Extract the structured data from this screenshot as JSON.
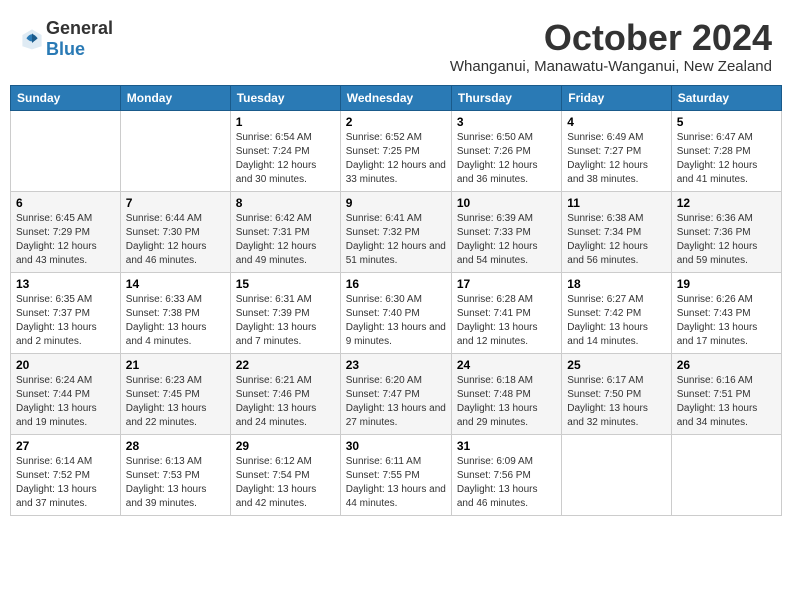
{
  "header": {
    "logo_general": "General",
    "logo_blue": "Blue",
    "month": "October 2024",
    "location": "Whanganui, Manawatu-Wanganui, New Zealand"
  },
  "weekdays": [
    "Sunday",
    "Monday",
    "Tuesday",
    "Wednesday",
    "Thursday",
    "Friday",
    "Saturday"
  ],
  "weeks": [
    [
      {
        "day": "",
        "info": ""
      },
      {
        "day": "",
        "info": ""
      },
      {
        "day": "1",
        "info": "Sunrise: 6:54 AM\nSunset: 7:24 PM\nDaylight: 12 hours and 30 minutes."
      },
      {
        "day": "2",
        "info": "Sunrise: 6:52 AM\nSunset: 7:25 PM\nDaylight: 12 hours and 33 minutes."
      },
      {
        "day": "3",
        "info": "Sunrise: 6:50 AM\nSunset: 7:26 PM\nDaylight: 12 hours and 36 minutes."
      },
      {
        "day": "4",
        "info": "Sunrise: 6:49 AM\nSunset: 7:27 PM\nDaylight: 12 hours and 38 minutes."
      },
      {
        "day": "5",
        "info": "Sunrise: 6:47 AM\nSunset: 7:28 PM\nDaylight: 12 hours and 41 minutes."
      }
    ],
    [
      {
        "day": "6",
        "info": "Sunrise: 6:45 AM\nSunset: 7:29 PM\nDaylight: 12 hours and 43 minutes."
      },
      {
        "day": "7",
        "info": "Sunrise: 6:44 AM\nSunset: 7:30 PM\nDaylight: 12 hours and 46 minutes."
      },
      {
        "day": "8",
        "info": "Sunrise: 6:42 AM\nSunset: 7:31 PM\nDaylight: 12 hours and 49 minutes."
      },
      {
        "day": "9",
        "info": "Sunrise: 6:41 AM\nSunset: 7:32 PM\nDaylight: 12 hours and 51 minutes."
      },
      {
        "day": "10",
        "info": "Sunrise: 6:39 AM\nSunset: 7:33 PM\nDaylight: 12 hours and 54 minutes."
      },
      {
        "day": "11",
        "info": "Sunrise: 6:38 AM\nSunset: 7:34 PM\nDaylight: 12 hours and 56 minutes."
      },
      {
        "day": "12",
        "info": "Sunrise: 6:36 AM\nSunset: 7:36 PM\nDaylight: 12 hours and 59 minutes."
      }
    ],
    [
      {
        "day": "13",
        "info": "Sunrise: 6:35 AM\nSunset: 7:37 PM\nDaylight: 13 hours and 2 minutes."
      },
      {
        "day": "14",
        "info": "Sunrise: 6:33 AM\nSunset: 7:38 PM\nDaylight: 13 hours and 4 minutes."
      },
      {
        "day": "15",
        "info": "Sunrise: 6:31 AM\nSunset: 7:39 PM\nDaylight: 13 hours and 7 minutes."
      },
      {
        "day": "16",
        "info": "Sunrise: 6:30 AM\nSunset: 7:40 PM\nDaylight: 13 hours and 9 minutes."
      },
      {
        "day": "17",
        "info": "Sunrise: 6:28 AM\nSunset: 7:41 PM\nDaylight: 13 hours and 12 minutes."
      },
      {
        "day": "18",
        "info": "Sunrise: 6:27 AM\nSunset: 7:42 PM\nDaylight: 13 hours and 14 minutes."
      },
      {
        "day": "19",
        "info": "Sunrise: 6:26 AM\nSunset: 7:43 PM\nDaylight: 13 hours and 17 minutes."
      }
    ],
    [
      {
        "day": "20",
        "info": "Sunrise: 6:24 AM\nSunset: 7:44 PM\nDaylight: 13 hours and 19 minutes."
      },
      {
        "day": "21",
        "info": "Sunrise: 6:23 AM\nSunset: 7:45 PM\nDaylight: 13 hours and 22 minutes."
      },
      {
        "day": "22",
        "info": "Sunrise: 6:21 AM\nSunset: 7:46 PM\nDaylight: 13 hours and 24 minutes."
      },
      {
        "day": "23",
        "info": "Sunrise: 6:20 AM\nSunset: 7:47 PM\nDaylight: 13 hours and 27 minutes."
      },
      {
        "day": "24",
        "info": "Sunrise: 6:18 AM\nSunset: 7:48 PM\nDaylight: 13 hours and 29 minutes."
      },
      {
        "day": "25",
        "info": "Sunrise: 6:17 AM\nSunset: 7:50 PM\nDaylight: 13 hours and 32 minutes."
      },
      {
        "day": "26",
        "info": "Sunrise: 6:16 AM\nSunset: 7:51 PM\nDaylight: 13 hours and 34 minutes."
      }
    ],
    [
      {
        "day": "27",
        "info": "Sunrise: 6:14 AM\nSunset: 7:52 PM\nDaylight: 13 hours and 37 minutes."
      },
      {
        "day": "28",
        "info": "Sunrise: 6:13 AM\nSunset: 7:53 PM\nDaylight: 13 hours and 39 minutes."
      },
      {
        "day": "29",
        "info": "Sunrise: 6:12 AM\nSunset: 7:54 PM\nDaylight: 13 hours and 42 minutes."
      },
      {
        "day": "30",
        "info": "Sunrise: 6:11 AM\nSunset: 7:55 PM\nDaylight: 13 hours and 44 minutes."
      },
      {
        "day": "31",
        "info": "Sunrise: 6:09 AM\nSunset: 7:56 PM\nDaylight: 13 hours and 46 minutes."
      },
      {
        "day": "",
        "info": ""
      },
      {
        "day": "",
        "info": ""
      }
    ]
  ]
}
